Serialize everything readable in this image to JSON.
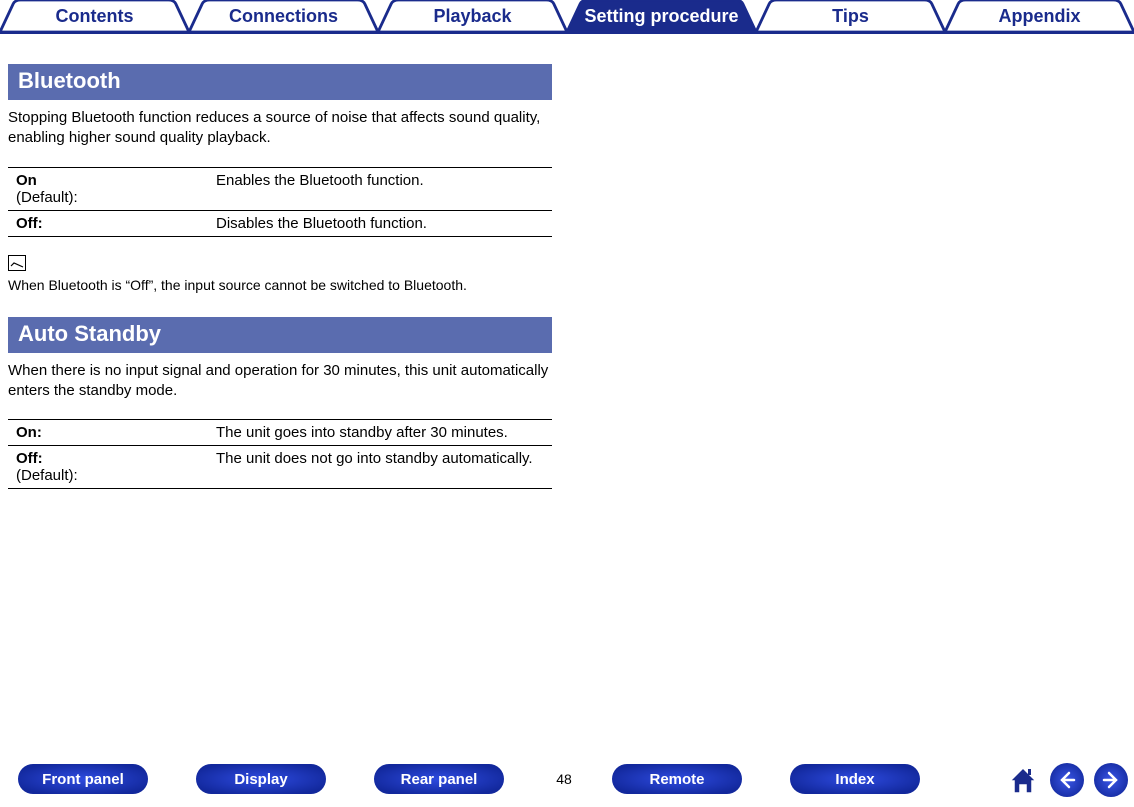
{
  "top_tabs": {
    "items": [
      {
        "label": "Contents",
        "active": false
      },
      {
        "label": "Connections",
        "active": false
      },
      {
        "label": "Playback",
        "active": false
      },
      {
        "label": "Setting procedure",
        "active": true
      },
      {
        "label": "Tips",
        "active": false
      },
      {
        "label": "Appendix",
        "active": false
      }
    ]
  },
  "sections": {
    "bluetooth": {
      "title": "Bluetooth",
      "desc": "Stopping Bluetooth function reduces a source of noise that affects sound quality, enabling higher sound quality playback.",
      "rows": [
        {
          "label_bold": "On",
          "label_extra": "(Default):",
          "value": "Enables the Bluetooth function."
        },
        {
          "label_bold": "Off:",
          "label_extra": "",
          "value": "Disables the Bluetooth function."
        }
      ],
      "note": "When Bluetooth is “Off”, the input source cannot be switched to Bluetooth."
    },
    "auto_standby": {
      "title": "Auto Standby",
      "desc": "When there is no input signal and operation for 30 minutes, this unit automatically enters the standby mode.",
      "rows": [
        {
          "label_bold": "On:",
          "label_extra": "",
          "value": "The unit goes into standby after 30 minutes."
        },
        {
          "label_bold": "Off:",
          "label_extra": "(Default):",
          "value": "The unit does not go into standby automatically."
        }
      ]
    }
  },
  "footer": {
    "pills": [
      "Front panel",
      "Display",
      "Rear panel",
      "Remote",
      "Index"
    ],
    "page_number": "48"
  }
}
